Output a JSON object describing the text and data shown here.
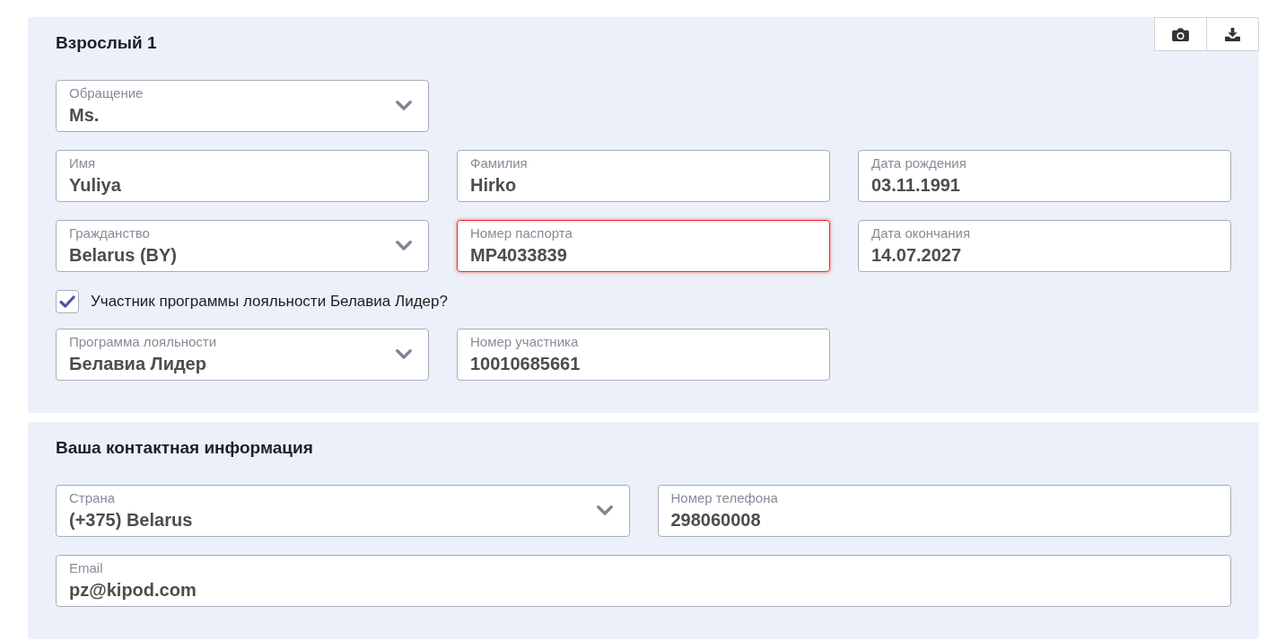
{
  "sections": [
    {
      "kind": "traveler",
      "title": "Взрослый 1",
      "rows": [
        [
          {
            "kind": "select",
            "label": "Обращение",
            "value": "Ms.",
            "invalid": false
          }
        ],
        [
          {
            "kind": "text",
            "label": "Имя",
            "value": "Yuliya",
            "invalid": false
          },
          {
            "kind": "text",
            "label": "Фамилия",
            "value": "Hirko",
            "invalid": false
          },
          {
            "kind": "text",
            "label": "Дата рождения",
            "value": "03.11.1991",
            "invalid": false
          }
        ],
        [
          {
            "kind": "select",
            "label": "Гражданство",
            "value": "Belarus (BY)",
            "invalid": false
          },
          {
            "kind": "text",
            "label": "Номер паспорта",
            "value": "MP4033839",
            "invalid": true
          },
          {
            "kind": "text",
            "label": "Дата окончания",
            "value": "14.07.2027",
            "invalid": false
          }
        ],
        [
          {
            "kind": "checkbox",
            "label": "Участник программы лояльности Белавиа Лидер?",
            "checked": true
          }
        ],
        [
          {
            "kind": "select",
            "label": "Программа лояльности",
            "value": "Белавиа Лидер",
            "invalid": false
          },
          {
            "kind": "text",
            "label": "Номер участника",
            "value": "10010685661",
            "invalid": false
          }
        ]
      ]
    },
    {
      "kind": "contact",
      "title": "Ваша контактная информация",
      "rows": [
        [
          {
            "kind": "select",
            "label": "Страна",
            "value": "(+375) Belarus",
            "invalid": false
          },
          {
            "kind": "text",
            "label": "Номер телефона",
            "value": "298060008",
            "invalid": false
          }
        ],
        [
          {
            "kind": "text",
            "label": "Email",
            "value": "pz@kipod.com",
            "invalid": false
          }
        ]
      ]
    }
  ]
}
